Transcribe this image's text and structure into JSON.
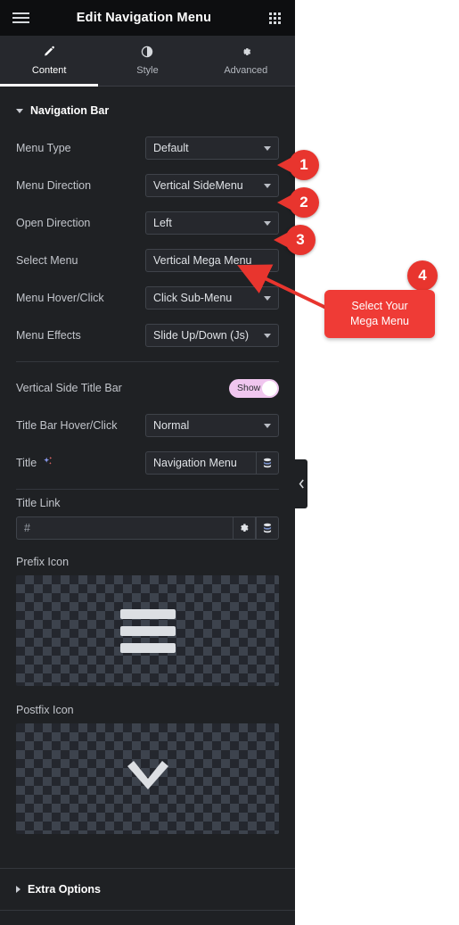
{
  "header": {
    "title": "Edit Navigation Menu",
    "menu_icon": "hamburger-icon",
    "apps_icon": "grid-apps-icon"
  },
  "tabs": [
    {
      "label": "Content",
      "icon": "pencil-icon",
      "active": true
    },
    {
      "label": "Style",
      "icon": "contrast-icon",
      "active": false
    },
    {
      "label": "Advanced",
      "icon": "gear-icon",
      "active": false
    }
  ],
  "section": {
    "title": "Navigation Bar",
    "expanded": true
  },
  "fields": {
    "menu_type": {
      "label": "Menu Type",
      "value": "Default"
    },
    "menu_direction": {
      "label": "Menu Direction",
      "value": "Vertical SideMenu"
    },
    "open_direction": {
      "label": "Open Direction",
      "value": "Left"
    },
    "select_menu": {
      "label": "Select Menu",
      "value": "Vertical Mega Menu"
    },
    "menu_hover_click": {
      "label": "Menu Hover/Click",
      "value": "Click Sub-Menu"
    },
    "menu_effects": {
      "label": "Menu Effects",
      "value": "Slide Up/Down (Js)"
    },
    "vertical_side_title_bar": {
      "label": "Vertical Side Title Bar",
      "toggle_label": "Show",
      "toggle_on": true
    },
    "title_bar_hover_click": {
      "label": "Title Bar Hover/Click",
      "value": "Normal"
    },
    "title": {
      "label": "Title",
      "value": "Navigation Menu",
      "ai_icon": "sparkle-ai-icon",
      "dynamic_icon": "database-icon"
    },
    "title_link": {
      "label": "Title Link",
      "value": "#",
      "settings_icon": "gear-icon",
      "dynamic_icon": "database-icon"
    },
    "prefix_icon": {
      "label": "Prefix Icon",
      "icon": "hamburger-icon"
    },
    "postfix_icon": {
      "label": "Postfix Icon",
      "icon": "chevron-down-icon"
    }
  },
  "extra_options": {
    "title": "Extra Options",
    "expanded": false
  },
  "collapse_tab": {
    "icon": "chevron-left-icon"
  },
  "annotations": {
    "badges": [
      {
        "number": "1"
      },
      {
        "number": "2"
      },
      {
        "number": "3"
      },
      {
        "number": "4"
      }
    ],
    "tooltip": {
      "line1": "Select Your",
      "line2": "Mega Menu"
    },
    "accent_color": "#e8352e"
  }
}
